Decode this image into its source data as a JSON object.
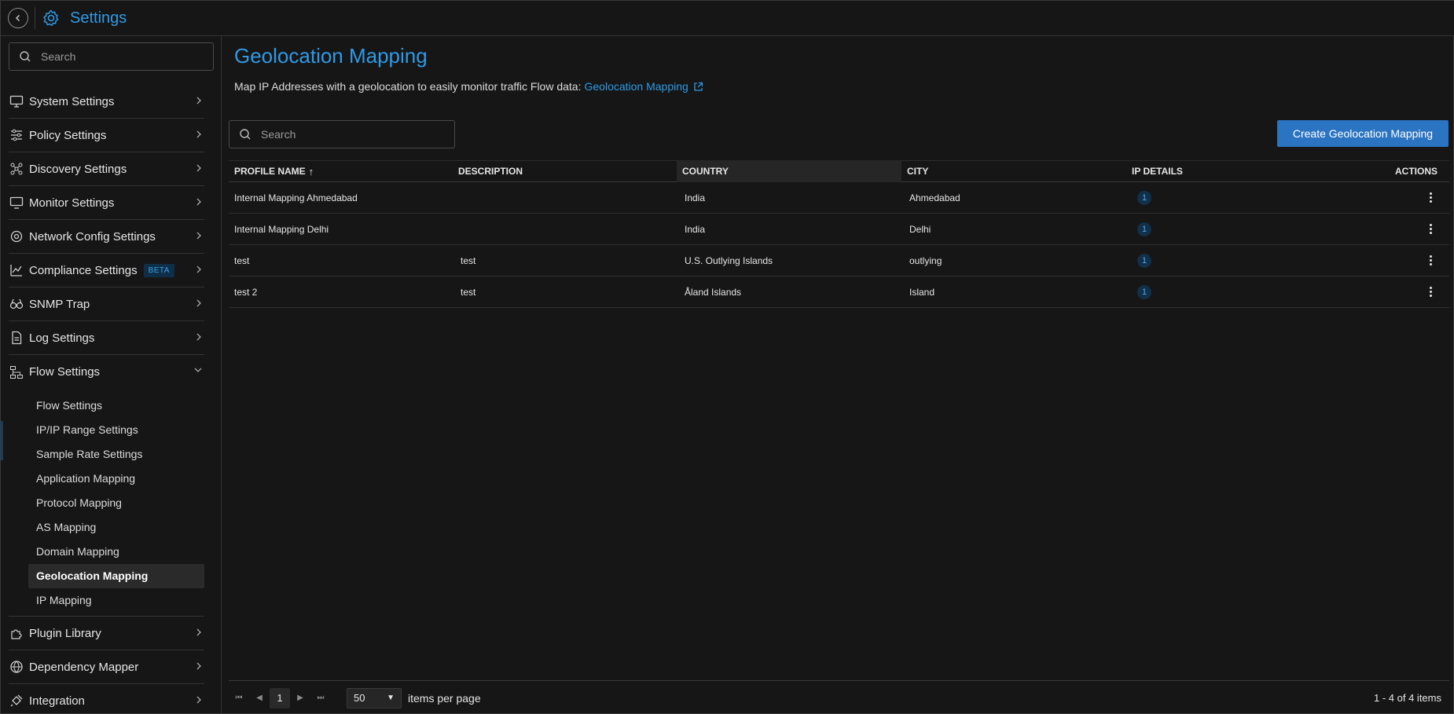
{
  "header": {
    "title": "Settings",
    "back_icon": "chevron-left-icon",
    "app_icon": "gear-icon"
  },
  "sidebar": {
    "search_placeholder": "Search",
    "items": [
      {
        "label": "System Settings",
        "icon": "monitor-settings-icon"
      },
      {
        "label": "Policy Settings",
        "icon": "sliders-icon"
      },
      {
        "label": "Discovery Settings",
        "icon": "network-icon"
      },
      {
        "label": "Monitor Settings",
        "icon": "monitor-icon"
      },
      {
        "label": "Network Config Settings",
        "icon": "config-icon"
      },
      {
        "label": "Compliance Settings",
        "icon": "compliance-icon",
        "badge": "BETA"
      },
      {
        "label": "SNMP Trap",
        "icon": "binoculars-icon"
      },
      {
        "label": "Log Settings",
        "icon": "document-icon"
      },
      {
        "label": "Flow Settings",
        "icon": "flow-icon",
        "expanded": true
      },
      {
        "label": "Plugin Library",
        "icon": "plugin-icon"
      },
      {
        "label": "Dependency Mapper",
        "icon": "globe-icon"
      },
      {
        "label": "Integration",
        "icon": "plug-icon"
      }
    ],
    "flow_sub_items": [
      "Flow Settings",
      "IP/IP Range Settings",
      "Sample Rate Settings",
      "Application Mapping",
      "Protocol Mapping",
      "AS Mapping",
      "Domain Mapping",
      "Geolocation Mapping",
      "IP Mapping"
    ],
    "active_sub_item": "Geolocation Mapping"
  },
  "main": {
    "title": "Geolocation Mapping",
    "description": "Map IP Addresses with a geolocation to easily monitor traffic Flow data:",
    "description_link": "Geolocation Mapping",
    "search_placeholder": "Search",
    "create_button": "Create Geolocation Mapping"
  },
  "table": {
    "columns": [
      "PROFILE NAME",
      "DESCRIPTION",
      "COUNTRY",
      "CITY",
      "IP DETAILS",
      "ACTIONS"
    ],
    "sort_indicator": "↑",
    "rows": [
      {
        "profile": "Internal Mapping Ahmedabad",
        "description": "",
        "country": "India",
        "city": "Ahmedabad",
        "ip_details": "1"
      },
      {
        "profile": "Internal Mapping Delhi",
        "description": "",
        "country": "India",
        "city": "Delhi",
        "ip_details": "1"
      },
      {
        "profile": "test",
        "description": "test",
        "country": "U.S. Outlying Islands",
        "city": "outlying",
        "ip_details": "1"
      },
      {
        "profile": "test 2",
        "description": "test",
        "country": "Åland Islands",
        "city": "Island",
        "ip_details": "1"
      }
    ]
  },
  "pager": {
    "current_page": "1",
    "page_size": "50",
    "items_per_page_label": "items per page",
    "count_text": "1 - 4 of 4 items"
  },
  "colors": {
    "accent": "#2e9ae6",
    "button": "#2b74c2",
    "background": "#161616"
  }
}
